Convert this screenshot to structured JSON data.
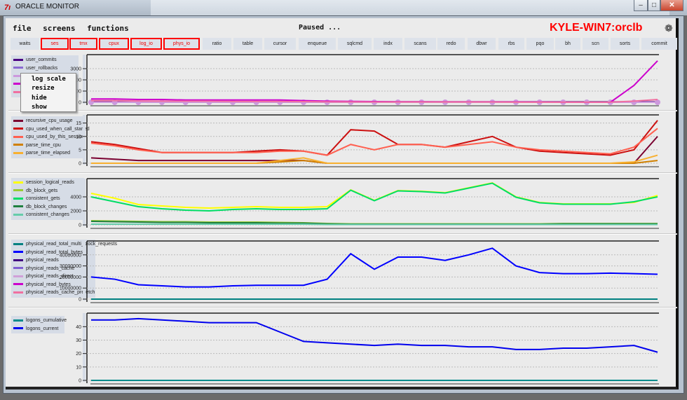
{
  "window": {
    "title": "ORACLE MONITOR",
    "app_icon": "7ı",
    "controls": [
      "minimize",
      "maximize",
      "close"
    ]
  },
  "menu": [
    "file",
    "screens",
    "functions"
  ],
  "status": "Paused ...",
  "host": "KYLE-WIN7:orclb",
  "settings_icon": "gear-icon",
  "tabs": [
    {
      "label": "waits",
      "hl": false
    },
    {
      "label": "ses",
      "hl": true
    },
    {
      "label": "tmx",
      "hl": true
    },
    {
      "label": "cpux",
      "hl": true
    },
    {
      "label": "log_io",
      "hl": true
    },
    {
      "label": "phys_io",
      "hl": true
    },
    {
      "label": "ratio",
      "hl": false
    },
    {
      "label": "table",
      "hl": false
    },
    {
      "label": "cursor",
      "hl": false
    },
    {
      "label": "enqueue",
      "hl": false
    },
    {
      "label": "sqlcmd",
      "hl": false
    },
    {
      "label": "indx",
      "hl": false
    },
    {
      "label": "scans",
      "hl": false
    },
    {
      "label": "redo",
      "hl": false
    },
    {
      "label": "dbwr",
      "hl": false
    },
    {
      "label": "rbs",
      "hl": false
    },
    {
      "label": "pqo",
      "hl": false
    },
    {
      "label": "bh",
      "hl": false
    },
    {
      "label": "scn",
      "hl": false
    },
    {
      "label": "sorts",
      "hl": false
    },
    {
      "label": "commit",
      "hl": false
    }
  ],
  "context_menu": [
    "log scale",
    "resize",
    "hide",
    "show"
  ],
  "accent": "#ff0000",
  "chart_data": [
    {
      "type": "line",
      "ylim": [
        0,
        4000
      ],
      "yticks": [
        "3000",
        "2000",
        "1000",
        "0"
      ],
      "tickvals": [
        3000,
        2000,
        1000,
        0
      ],
      "grid": true,
      "series": [
        {
          "name": "user_commits",
          "color": "#4b0082",
          "values": [
            50,
            50,
            50,
            50,
            50,
            50,
            50,
            50,
            50,
            50,
            50,
            50,
            50,
            40,
            40,
            40,
            40,
            40,
            40,
            40,
            40,
            40,
            40,
            40,
            40
          ]
        },
        {
          "name": "user_rollbacks",
          "color": "#8a6ad0",
          "values": [
            0,
            0,
            0,
            0,
            0,
            0,
            0,
            0,
            0,
            0,
            0,
            0,
            0,
            0,
            0,
            0,
            0,
            0,
            0,
            0,
            0,
            0,
            0,
            0,
            0
          ]
        },
        {
          "name": "",
          "color": "#cc99dd",
          "markers": true,
          "values": [
            0,
            0,
            0,
            0,
            0,
            0,
            0,
            0,
            0,
            0,
            0,
            0,
            0,
            0,
            0,
            0,
            0,
            0,
            0,
            0,
            0,
            0,
            0,
            0,
            0
          ]
        },
        {
          "name": "",
          "color": "#cc00cc",
          "values": [
            300,
            300,
            250,
            250,
            200,
            200,
            200,
            200,
            200,
            150,
            100,
            80,
            60,
            50,
            50,
            40,
            40,
            40,
            30,
            20,
            10,
            0,
            0,
            1500,
            3700
          ]
        },
        {
          "name": "",
          "color": "#f070a0",
          "values": [
            150,
            150,
            120,
            100,
            100,
            100,
            80,
            80,
            80,
            60,
            40,
            30,
            20,
            20,
            20,
            20,
            20,
            20,
            10,
            10,
            10,
            10,
            10,
            100,
            250
          ]
        }
      ]
    },
    {
      "type": "line",
      "ylim": [
        0,
        17
      ],
      "yticks": [
        "15",
        "10",
        "5",
        "0"
      ],
      "tickvals": [
        15,
        10,
        5,
        0
      ],
      "grid": true,
      "series": [
        {
          "name": "recursive_cpu_usage",
          "color": "#7a0030",
          "values": [
            2,
            1.5,
            1,
            1,
            1,
            1,
            1,
            1,
            1,
            1,
            0,
            0,
            0,
            0,
            0,
            0,
            0,
            0,
            0,
            0,
            0,
            0,
            0,
            0,
            10
          ]
        },
        {
          "name": "cpu_used_when_call_started",
          "color": "#cc1010",
          "values": [
            8,
            7,
            5.5,
            4,
            4,
            4,
            4,
            4.5,
            5,
            4.5,
            3,
            12.5,
            12,
            7,
            7,
            6,
            8,
            10,
            6,
            4.5,
            4,
            3.5,
            3,
            5,
            16
          ]
        },
        {
          "name": "cpu_used_by_this_session",
          "color": "#ff6050",
          "values": [
            7.5,
            6.5,
            5,
            4,
            4,
            4,
            4,
            4,
            4.5,
            4.5,
            3,
            7,
            5,
            7,
            7,
            6,
            7,
            8,
            6,
            5,
            4.5,
            4,
            3.5,
            6,
            13
          ]
        },
        {
          "name": "parse_time_cpu",
          "color": "#d08000",
          "values": [
            0,
            0,
            0,
            0,
            0,
            0,
            0,
            0,
            0.5,
            1,
            0,
            0,
            0,
            0,
            0,
            0,
            0,
            0,
            0,
            0,
            0,
            0,
            0,
            0,
            1
          ]
        },
        {
          "name": "parse_time_elapsed",
          "color": "#f8b030",
          "values": [
            0,
            0,
            0,
            0,
            0,
            0,
            0,
            0,
            1,
            2,
            0,
            0,
            0,
            0,
            0,
            0,
            0,
            0,
            0,
            0,
            0,
            0,
            0,
            0.5,
            3
          ]
        }
      ]
    },
    {
      "type": "line",
      "ylim": [
        0,
        6200
      ],
      "yticks": [
        "4000",
        "2000",
        "0"
      ],
      "tickvals": [
        4000,
        2000,
        0
      ],
      "grid": true,
      "series": [
        {
          "name": "session_logical_reads",
          "color": "#ffff00",
          "values": [
            4500,
            3800,
            2900,
            2700,
            2500,
            2400,
            2500,
            2600,
            2500,
            2500,
            2600,
            5000,
            3500,
            4900,
            4800,
            4600,
            5300,
            6000,
            4000,
            3200,
            3000,
            3000,
            3000,
            3200,
            4200
          ]
        },
        {
          "name": "db_block_gets",
          "color": "#99cc33",
          "values": [
            600,
            550,
            500,
            450,
            450,
            400,
            400,
            400,
            350,
            300,
            200,
            150,
            150,
            150,
            150,
            150,
            150,
            150,
            150,
            150,
            200,
            200,
            200,
            200,
            200
          ]
        },
        {
          "name": "consistent_gets",
          "color": "#00dd66",
          "values": [
            4000,
            3300,
            2600,
            2300,
            2100,
            2000,
            2200,
            2300,
            2200,
            2200,
            2300,
            4950,
            3450,
            4850,
            4750,
            4550,
            5250,
            5950,
            3950,
            3150,
            2950,
            2950,
            2950,
            3300,
            4000
          ]
        },
        {
          "name": "db_block_changes",
          "color": "#208040",
          "values": [
            500,
            450,
            400,
            350,
            350,
            300,
            300,
            300,
            250,
            250,
            150,
            100,
            100,
            100,
            100,
            100,
            100,
            100,
            100,
            100,
            150,
            150,
            150,
            150,
            150
          ]
        },
        {
          "name": "consistent_changes",
          "color": "#66ccaa",
          "values": [
            100,
            100,
            100,
            100,
            100,
            100,
            100,
            100,
            100,
            100,
            50,
            50,
            50,
            50,
            50,
            50,
            50,
            50,
            50,
            50,
            50,
            50,
            50,
            50,
            50
          ]
        }
      ]
    },
    {
      "type": "line",
      "ylim": [
        0,
        50000000
      ],
      "yticks": [
        "40000000",
        "30000000",
        "20000000",
        "10000000",
        "0"
      ],
      "tickvals": [
        40000000,
        30000000,
        20000000,
        10000000,
        0
      ],
      "grid": true,
      "series": [
        {
          "name": "physical_read_total_multi_block_requests",
          "color": "#008080",
          "values": [
            0,
            0,
            0,
            0,
            0,
            0,
            0,
            0,
            0,
            0,
            0,
            0,
            0,
            0,
            0,
            0,
            0,
            0,
            0,
            0,
            0,
            0,
            0,
            0,
            0
          ]
        },
        {
          "name": "physical_read_total_bytes",
          "color": "#0000ff",
          "values": [
            20000000,
            18000000,
            13000000,
            12000000,
            11000000,
            11000000,
            12000000,
            12500000,
            12500000,
            12500000,
            18000000,
            41000000,
            27000000,
            38000000,
            38000000,
            35000000,
            40000000,
            46000000,
            30000000,
            24000000,
            23000000,
            23000000,
            23500000,
            23000000,
            22500000
          ]
        },
        {
          "name": "physical_reads",
          "color": "#400080",
          "values": []
        },
        {
          "name": "physical_reads_cache",
          "color": "#8060d0",
          "values": []
        },
        {
          "name": "physical_reads_direct",
          "color": "#d0a0d8",
          "values": []
        },
        {
          "name": "physical_read_bytes",
          "color": "#cc00cc",
          "values": []
        },
        {
          "name": "physical_reads_cache_prefetch",
          "color": "#f070a0",
          "values": []
        }
      ]
    },
    {
      "type": "line",
      "ylim": [
        0,
        48
      ],
      "yticks": [
        "40",
        "30",
        "20",
        "10",
        "0"
      ],
      "tickvals": [
        40,
        30,
        20,
        10,
        0
      ],
      "grid": true,
      "series": [
        {
          "name": "logons_cumulative",
          "color": "#008b8b",
          "values": [
            0,
            0,
            0,
            0,
            0,
            0,
            0,
            0,
            0,
            0,
            0,
            0,
            0,
            0,
            0,
            0,
            0,
            0,
            0,
            0,
            0,
            0,
            0,
            0,
            0
          ]
        },
        {
          "name": "logons_current",
          "color": "#0000ee",
          "values": [
            45,
            45,
            46,
            45,
            44,
            43,
            43,
            43,
            36,
            29,
            28,
            27,
            26,
            27,
            26,
            26,
            25,
            25,
            23,
            23,
            24,
            24,
            25,
            26,
            21
          ]
        }
      ]
    }
  ]
}
